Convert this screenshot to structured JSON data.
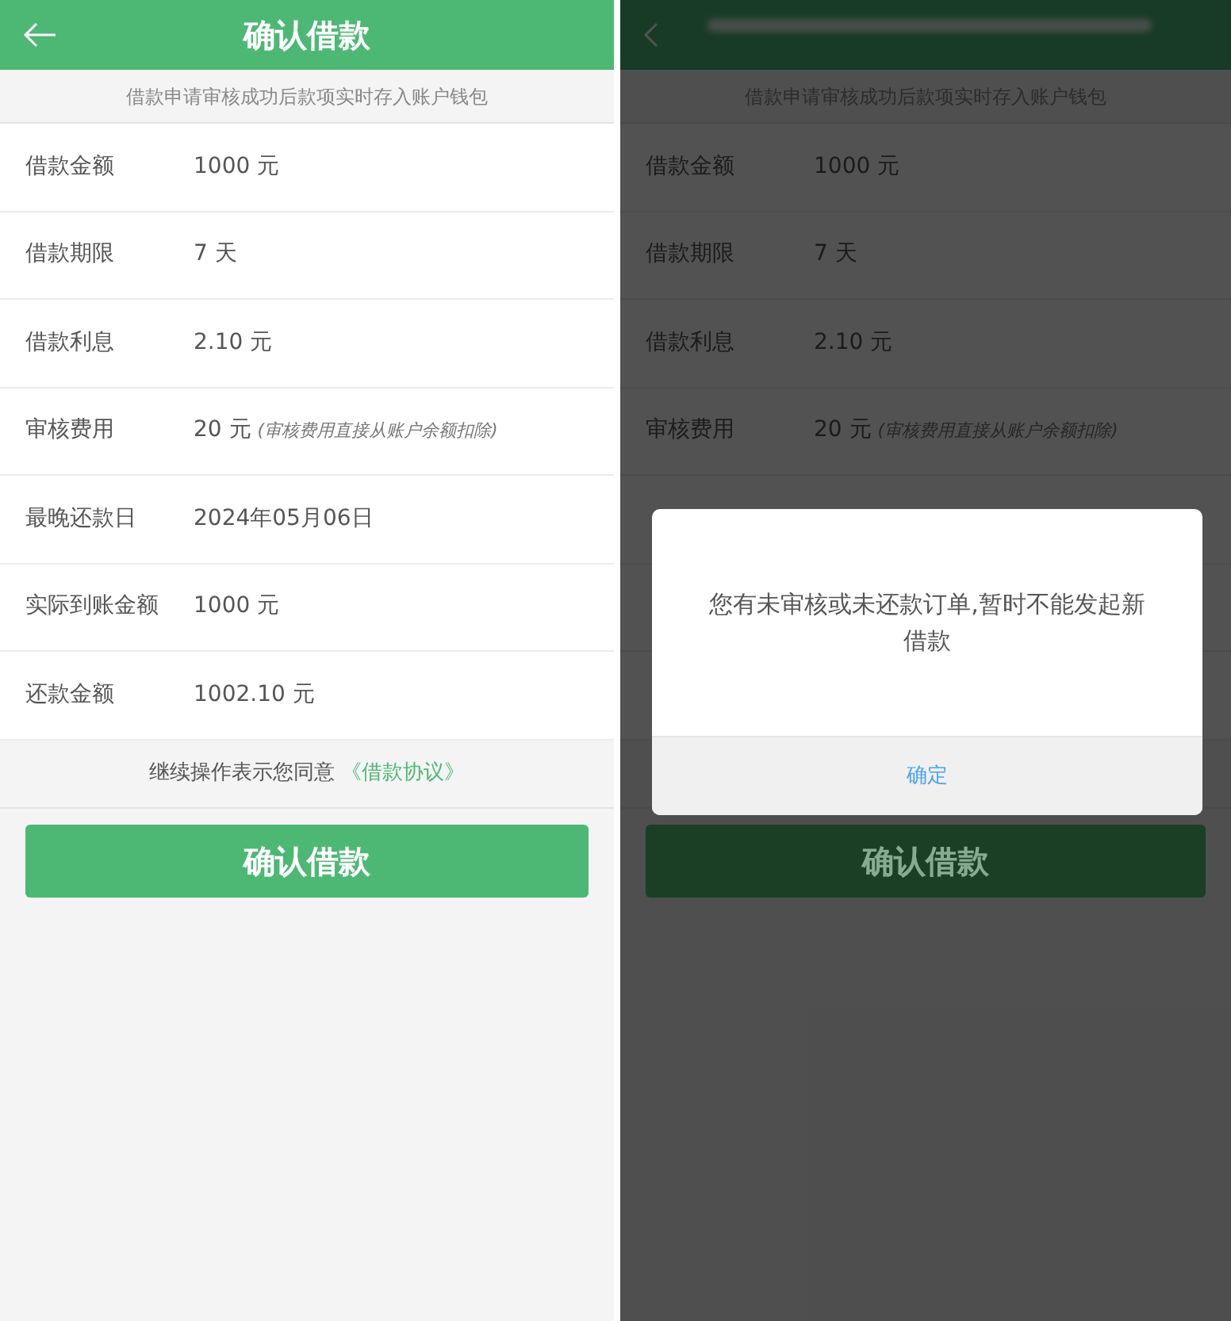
{
  "left_screen": {
    "header": {
      "title": "确认借款"
    },
    "notice": "借款申请审核成功后款项实时存入账户钱包",
    "rows": [
      {
        "label": "借款金额",
        "value": "1000 元"
      },
      {
        "label": "借款期限",
        "value": "7 天"
      },
      {
        "label": "借款利息",
        "value": "2.10 元"
      },
      {
        "label": "审核费用",
        "value": "20 元",
        "note": "(审核费用直接从账户余额扣除)"
      },
      {
        "label": "最晚还款日",
        "value": "2024年05月06日"
      },
      {
        "label": "实际到账金额",
        "value": "1000 元"
      },
      {
        "label": "还款金额",
        "value": "1002.10 元"
      }
    ],
    "agreement": {
      "text": "继续操作表示您同意",
      "link": "《借款协议》"
    },
    "confirm_button": "确认借款"
  },
  "right_screen": {
    "notice": "借款申请审核成功后款项实时存入账户钱包",
    "rows": [
      {
        "label": "借款金额",
        "value": "1000 元"
      },
      {
        "label": "借款期限",
        "value": "7 天"
      },
      {
        "label": "借款利息",
        "value": "2.10 元"
      },
      {
        "label": "审核费用",
        "value": "20 元",
        "note": "(审核费用直接从账户余额扣除)"
      }
    ],
    "confirm_button": "确认借款",
    "dialog": {
      "message": "您有未审核或未还款订单,暂时不能发起新借款",
      "button": "确定"
    }
  }
}
